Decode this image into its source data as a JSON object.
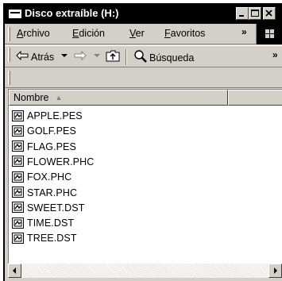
{
  "window": {
    "title": "Disco extraíble (H:)"
  },
  "menu": {
    "items": [
      {
        "key": "A",
        "rest": "rchivo"
      },
      {
        "key": "E",
        "rest": "dición"
      },
      {
        "key": "V",
        "rest": "er"
      },
      {
        "key": "F",
        "rest": "avoritos"
      }
    ],
    "overflow": "»"
  },
  "toolbar": {
    "back_label": "Atrás",
    "search_label": "Búsqueda",
    "overflow": "»"
  },
  "list": {
    "column_name": "Nombre",
    "files": [
      "APPLE.PES",
      "GOLF.PES",
      "FLAG.PES",
      "FLOWER.PHC",
      "FOX.PHC",
      "STAR.PHC",
      "SWEET.DST",
      "TIME.DST",
      "TREE.DST"
    ]
  },
  "icons": {
    "title": "folder-icon",
    "file": "document-icon",
    "back": "back-arrow-icon",
    "forward": "forward-arrow-icon",
    "up": "up-folder-icon",
    "search": "search-icon",
    "windows": "windows-flag-icon"
  }
}
